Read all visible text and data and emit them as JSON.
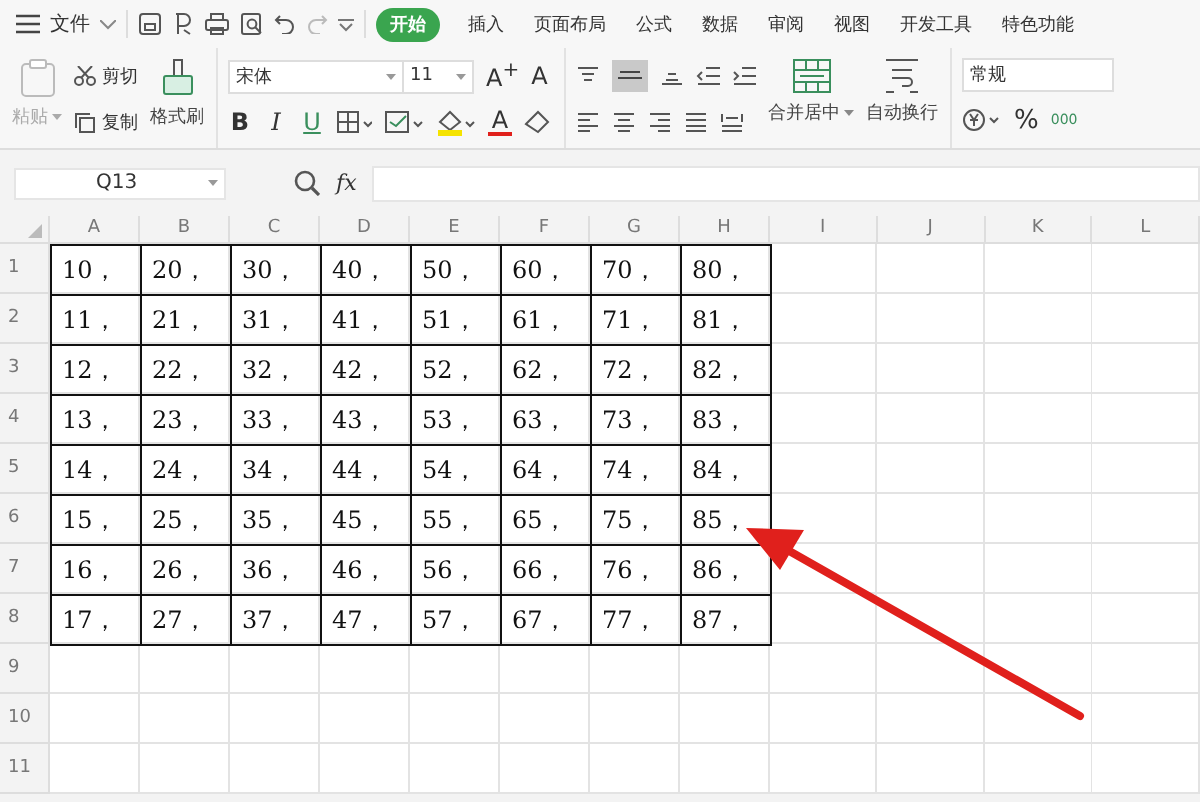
{
  "menu": {
    "file": "文件"
  },
  "tabs": [
    {
      "label": "开始",
      "selected": true
    },
    {
      "label": "插入",
      "selected": false
    },
    {
      "label": "页面布局",
      "selected": false
    },
    {
      "label": "公式",
      "selected": false
    },
    {
      "label": "数据",
      "selected": false
    },
    {
      "label": "审阅",
      "selected": false
    },
    {
      "label": "视图",
      "selected": false
    },
    {
      "label": "开发工具",
      "selected": false
    },
    {
      "label": "特色功能",
      "selected": false
    }
  ],
  "ribbon": {
    "paste": {
      "label": "粘贴",
      "disabled": true
    },
    "cut": "剪切",
    "copy": "复制",
    "format_painter": "格式刷",
    "font": "宋体",
    "font_size": "11",
    "size_buttons": [
      "A$^{+}$",
      "A"
    ],
    "style_buttons": [
      "B",
      "I",
      "U"
    ],
    "color_button": "A",
    "merge": "合并居中",
    "wrap": "自动换行",
    "number_format": "常规",
    "percent": "%",
    "thousands": "000"
  },
  "formula_bar": {
    "name_box": "Q13",
    "fx": "fx"
  },
  "columns": [
    "A",
    "B",
    "C",
    "D",
    "E",
    "F",
    "G",
    "H",
    "I",
    "J",
    "K",
    "L"
  ],
  "rows": [
    {
      "header": "1",
      "cells": [
        "10，",
        "20，",
        "30，",
        "40，",
        "50，",
        "60，",
        "70，",
        "80，"
      ]
    },
    {
      "header": "2",
      "cells": [
        "11，",
        "21，",
        "31，",
        "41，",
        "51，",
        "61，",
        "71，",
        "81，"
      ]
    },
    {
      "header": "3",
      "cells": [
        "12，",
        "22，",
        "32，",
        "42，",
        "52，",
        "62，",
        "72，",
        "82，"
      ]
    },
    {
      "header": "4",
      "cells": [
        "13，",
        "23，",
        "33，",
        "43，",
        "53，",
        "63，",
        "73，",
        "83，"
      ]
    },
    {
      "header": "5",
      "cells": [
        "14，",
        "24，",
        "34，",
        "44，",
        "54，",
        "64，",
        "74，",
        "84，"
      ]
    },
    {
      "header": "6",
      "cells": [
        "15，",
        "25，",
        "35，",
        "45，",
        "55，",
        "65，",
        "75，",
        "85，"
      ]
    },
    {
      "header": "7",
      "cells": [
        "16，",
        "26，",
        "36，",
        "46，",
        "56，",
        "66，",
        "76，",
        "86，"
      ]
    },
    {
      "header": "8",
      "cells": [
        "17，",
        "27，",
        "37，",
        "47，",
        "57，",
        "67，",
        "77，",
        "87，"
      ]
    },
    {
      "header": "9"
    },
    {
      "header": "10"
    },
    {
      "header": "11"
    }
  ]
}
